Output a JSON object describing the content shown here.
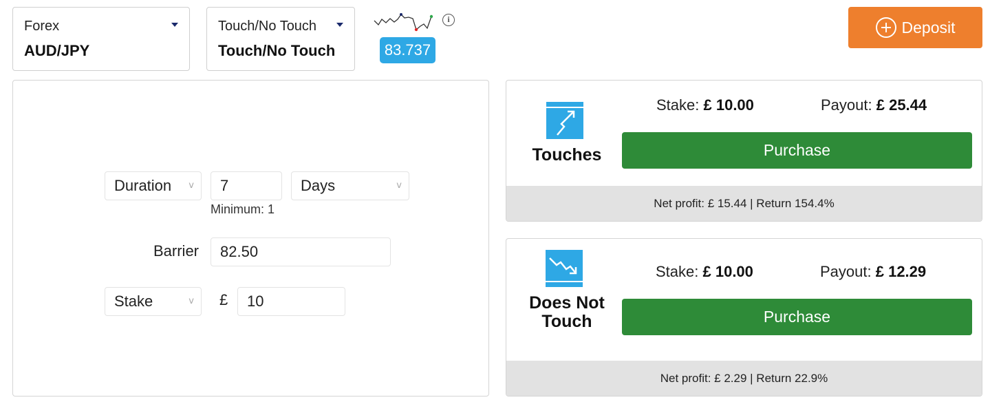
{
  "market": {
    "category": "Forex",
    "symbol": "AUD/JPY"
  },
  "trade_type": {
    "category": "Touch/No Touch",
    "selected": "Touch/No Touch"
  },
  "spot_price": "83.737",
  "info_glyph": "i",
  "deposit": {
    "label": "Deposit"
  },
  "params": {
    "duration_select": "Duration",
    "duration_value": "7",
    "duration_unit": "Days",
    "minimum_hint": "Minimum: 1",
    "barrier_label": "Barrier",
    "barrier_value": "82.50",
    "stake_select": "Stake",
    "currency_symbol": "£",
    "stake_value": "10"
  },
  "contracts": [
    {
      "name": "Touches",
      "stake_label": "Stake:",
      "stake_value": "£ 10.00",
      "payout_label": "Payout:",
      "payout_value": "£ 25.44",
      "purchase_label": "Purchase",
      "footer": "Net profit: £ 15.44 | Return 154.4%"
    },
    {
      "name": "Does Not Touch",
      "stake_label": "Stake:",
      "stake_value": "£ 10.00",
      "payout_label": "Payout:",
      "payout_value": "£ 12.29",
      "purchase_label": "Purchase",
      "footer": "Net profit: £ 2.29 | Return 22.9%"
    }
  ],
  "colors": {
    "accent_blue": "#2ea8e5",
    "deposit_orange": "#ee7f2d",
    "purchase_green": "#2e8b38",
    "footer_gray": "#e2e2e2"
  },
  "icons": {
    "caret": "caret-down-icon",
    "info": "info-icon",
    "deposit": "plus-circle-icon",
    "touch": "touch-contract-icon",
    "no_touch": "no-touch-contract-icon",
    "select_chevron": "chevron-down-icon"
  }
}
